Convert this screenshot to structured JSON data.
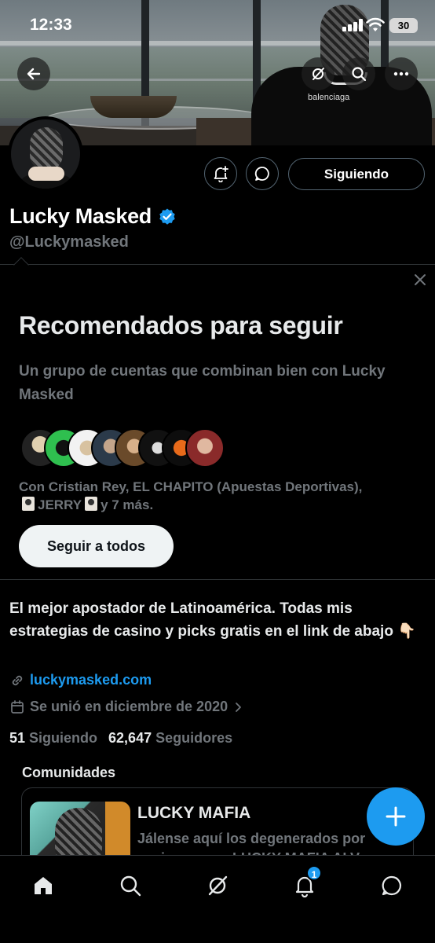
{
  "status_bar": {
    "time": "12:33",
    "battery": "30"
  },
  "header": {
    "follow_button": "Siguiendo"
  },
  "profile": {
    "name": "Lucky Masked",
    "handle": "@Luckymasked",
    "bio": "El mejor apostador de Latinoamérica. Todas mis estrategias de casino y picks gratis en el link de abajo 👇🏻",
    "link": "luckymasked.com",
    "joined": "Se unió en diciembre de 2020",
    "following_count": "51",
    "following_label": "Siguiendo",
    "followers_count": "62,647",
    "followers_label": "Seguidores",
    "banner_brand": "balenciaga"
  },
  "recommendations": {
    "title": "Recomendados para seguir",
    "subtitle": "Un grupo de cuentas que combinan bien con Lucky Masked",
    "with_text_1": "Con Cristian Rey, EL CHAPITO (Apuestas Deportivas),",
    "with_text_2": "JERRY",
    "with_text_3": "y 7 más.",
    "follow_all": "Seguir a todos"
  },
  "communities": {
    "title": "Comunidades",
    "name": "LUCKY MAFIA",
    "description": "Jálense aquí los degenerados por casino y pura LUCKY MAFIA ALV"
  },
  "nav": {
    "notifications_badge": "1"
  },
  "colors": {
    "accent": "#1d9bf0",
    "muted": "#71767b",
    "text": "#e7e9ea",
    "border": "#2f3336"
  }
}
